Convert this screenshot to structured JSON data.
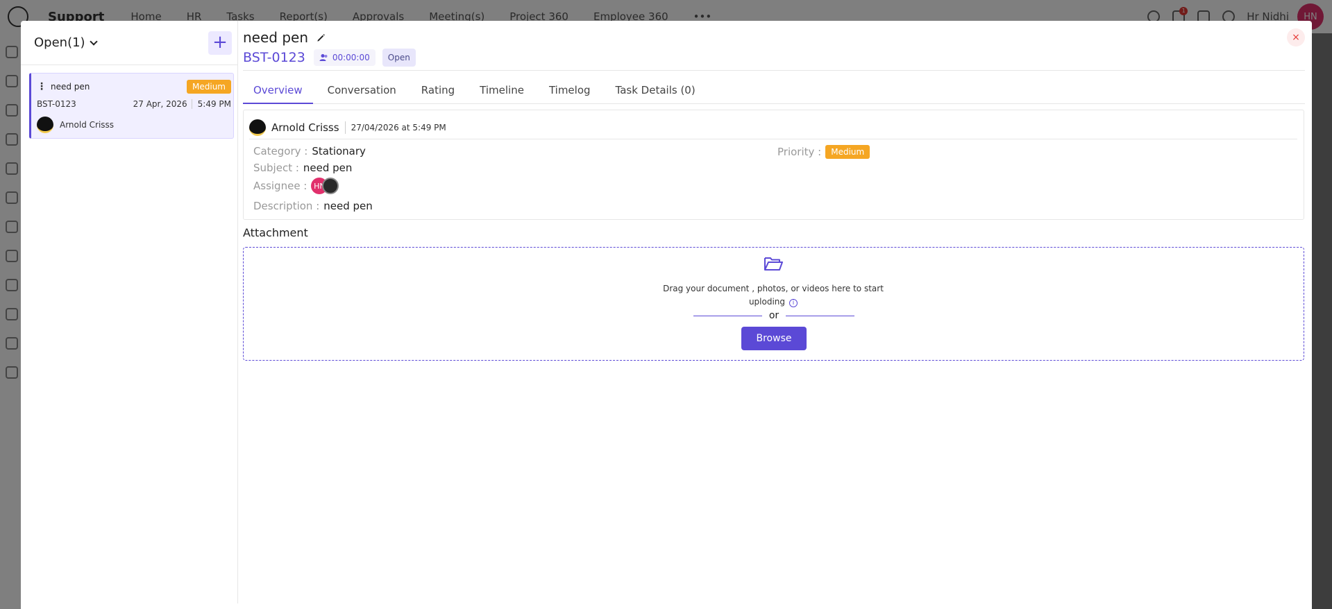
{
  "app": {
    "brand": "Support",
    "nav": [
      "Home",
      "HR",
      "Tasks",
      "Report(s)",
      "Approvals",
      "Meeting(s)",
      "Project 360",
      "Employee 360"
    ],
    "more": "•••",
    "notification_count": "1",
    "user_name": "Hr Nidhi",
    "user_initials": "HN"
  },
  "list_panel": {
    "filter_label": "Open(1)",
    "add_label": "+",
    "tickets": [
      {
        "title": "need pen",
        "priority": "Medium",
        "id": "BST-0123",
        "date": "27 Apr, 2026",
        "time": "5:49 PM",
        "owner": "Arnold Crisss"
      }
    ]
  },
  "ticket": {
    "title": "need pen",
    "id": "BST-0123",
    "timer": "00:00:00",
    "status": "Open",
    "close_label": "×"
  },
  "tabs": [
    "Overview",
    "Conversation",
    "Rating",
    "Timeline",
    "Timelog",
    "Task Details (0)"
  ],
  "overview": {
    "author": "Arnold Crisss",
    "created_at": "27/04/2026 at  5:49 PM",
    "category_label": "Category :",
    "category": "Stationary",
    "subject_label": "Subject :",
    "subject": "need pen",
    "assignee_label": "Assignee :",
    "assignee_initials": "HN",
    "description_label": "Description :",
    "description": "need pen",
    "priority_label": "Priority :",
    "priority": "Medium"
  },
  "attachment": {
    "title": "Attachment",
    "drop_text": "Drag your document , photos, or videos here to start uploding",
    "info": "i",
    "or_text": "or",
    "browse_label": "Browse"
  },
  "colors": {
    "accent": "#5b49d6",
    "priority_medium": "#f5a623",
    "close": "#e53935"
  }
}
